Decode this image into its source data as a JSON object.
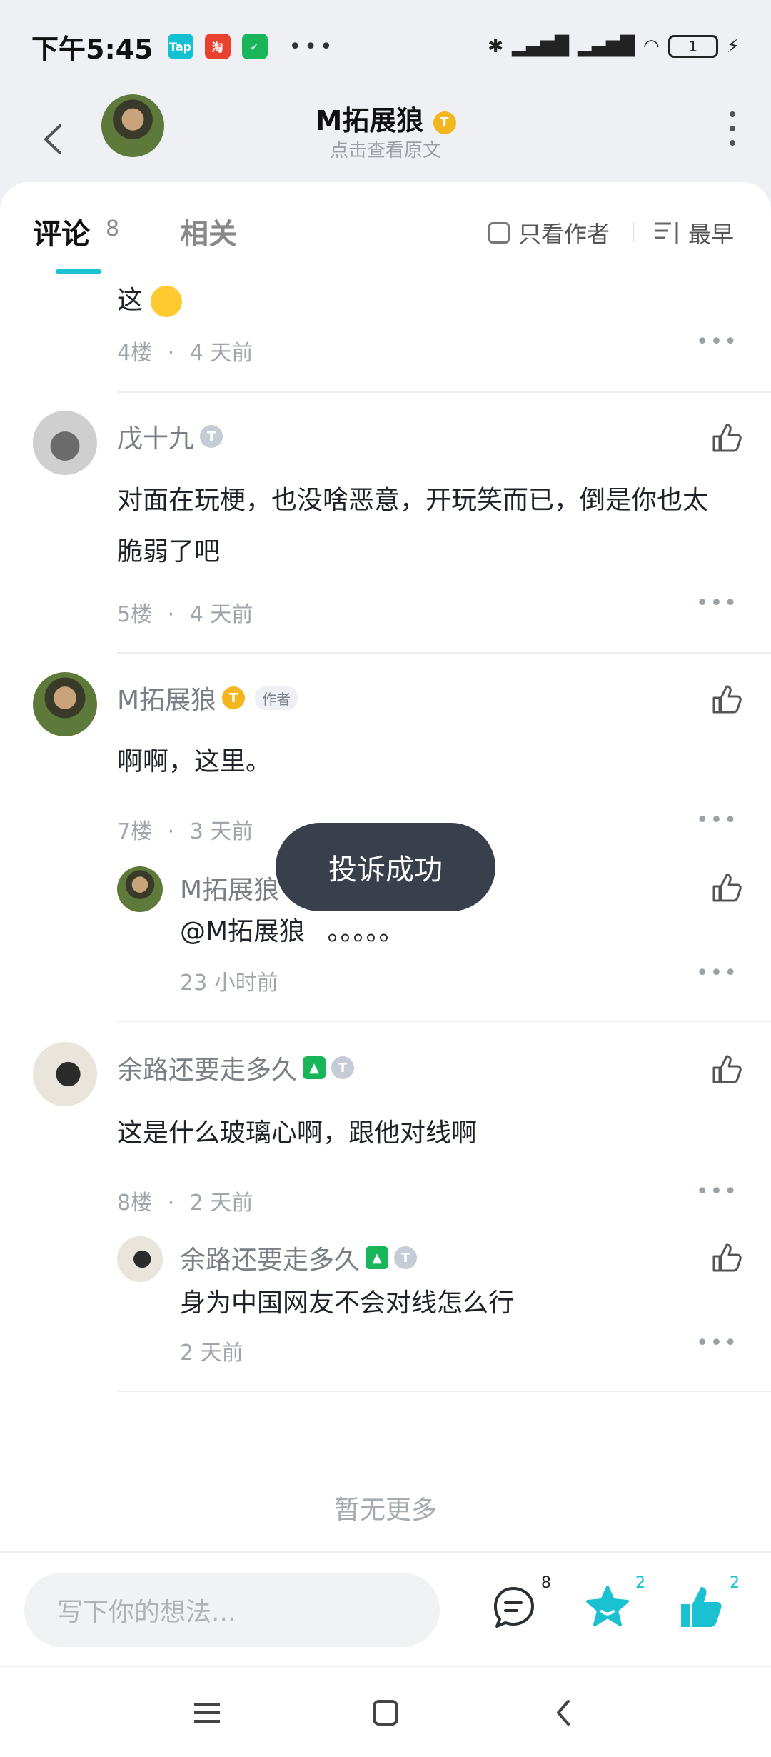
{
  "status": {
    "time": "下午5:45",
    "apps": [
      "Tap",
      "淘",
      "✓"
    ],
    "dots": "•••",
    "battery": "1"
  },
  "header": {
    "title": "M拓展狼",
    "subtitle": "点击查看原文"
  },
  "tabs": {
    "comments_label": "评论",
    "comments_count": "8",
    "related_label": "相关",
    "only_author_label": "只看作者",
    "sort_label": "最早"
  },
  "comments": [
    {
      "text": "这",
      "floor": "4楼",
      "time": "4 天前"
    },
    {
      "name": "戊十九",
      "level": "2",
      "text_line1": "对面在玩梗，也没啥恶意，开玩笑而已，倒是你也太",
      "text_line2": "脆弱了吧",
      "floor": "5楼",
      "time": "4 天前"
    },
    {
      "name": "M拓展狼",
      "level": "1",
      "author_tag": "作者",
      "text": "啊啊，这里。",
      "floor": "7楼",
      "time": "3 天前",
      "reply": {
        "name": "M拓展狼",
        "mention": "@M拓展狼",
        "text": "。。。。。",
        "time": "23 小时前"
      }
    },
    {
      "name": "余路还要走多久",
      "level": "1",
      "text": "这是什么玻璃心啊，跟他对线啊",
      "floor": "8楼",
      "time": "2 天前",
      "reply": {
        "name": "余路还要走多久",
        "level": "1",
        "text": "身为中国网友不会对线怎么行",
        "time": "2 天前"
      }
    }
  ],
  "separator_dot": "·",
  "toast": "投诉成功",
  "no_more": "暂无更多",
  "bottom": {
    "input_placeholder": "写下你的想法...",
    "comment_count": "8",
    "favorite_count": "2",
    "like_count": "2"
  },
  "colors": {
    "accent": "#19c1d1",
    "gold_badge": "#f3b61f",
    "green_badge": "#19b55a",
    "toast_bg": "#3a3f4c"
  },
  "icons": [
    "back-icon",
    "more-vertical-icon",
    "checkbox-icon",
    "sort-icon",
    "thumbs-up-icon",
    "more-horizontal-icon",
    "comment-icon",
    "star-icon",
    "menu-icon",
    "home-icon",
    "nav-back-icon"
  ]
}
